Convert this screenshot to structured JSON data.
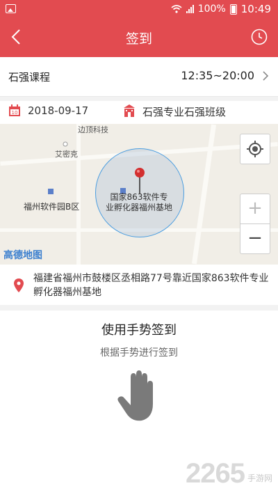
{
  "status_bar": {
    "battery": "100%",
    "time": "10:49"
  },
  "header": {
    "title": "签到"
  },
  "course": {
    "name": "石强课程",
    "time": "12:35~20:00"
  },
  "info": {
    "date": "2018-09-17",
    "class_name": "石强专业石强班级"
  },
  "map": {
    "labels": {
      "top": "边顶科技",
      "poi1": "艾密克",
      "poi2": "福州软件园B区"
    },
    "poi_label_line1": "国家863软件专",
    "poi_label_line2": "业孵化器福州基地",
    "logo": "高德地图",
    "zoom_in": "+",
    "zoom_out": "−"
  },
  "address": {
    "text": "福建省福州市鼓楼区丞相路77号靠近国家863软件专业孵化器福州基地"
  },
  "gesture": {
    "title": "使用手势签到",
    "subtitle": "根据手势进行签到"
  },
  "watermark": {
    "number": "2265",
    "site": "手游网"
  },
  "colors": {
    "brand": "#e24b50",
    "map_circle": "#4a9de0"
  },
  "icons": [
    "image-icon",
    "wifi-icon",
    "signal-icon",
    "battery-icon",
    "back-icon",
    "clock-icon",
    "chevron-right-icon",
    "calendar-icon",
    "school-icon",
    "locate-icon",
    "map-pin-icon",
    "location-icon",
    "hand-icon"
  ]
}
